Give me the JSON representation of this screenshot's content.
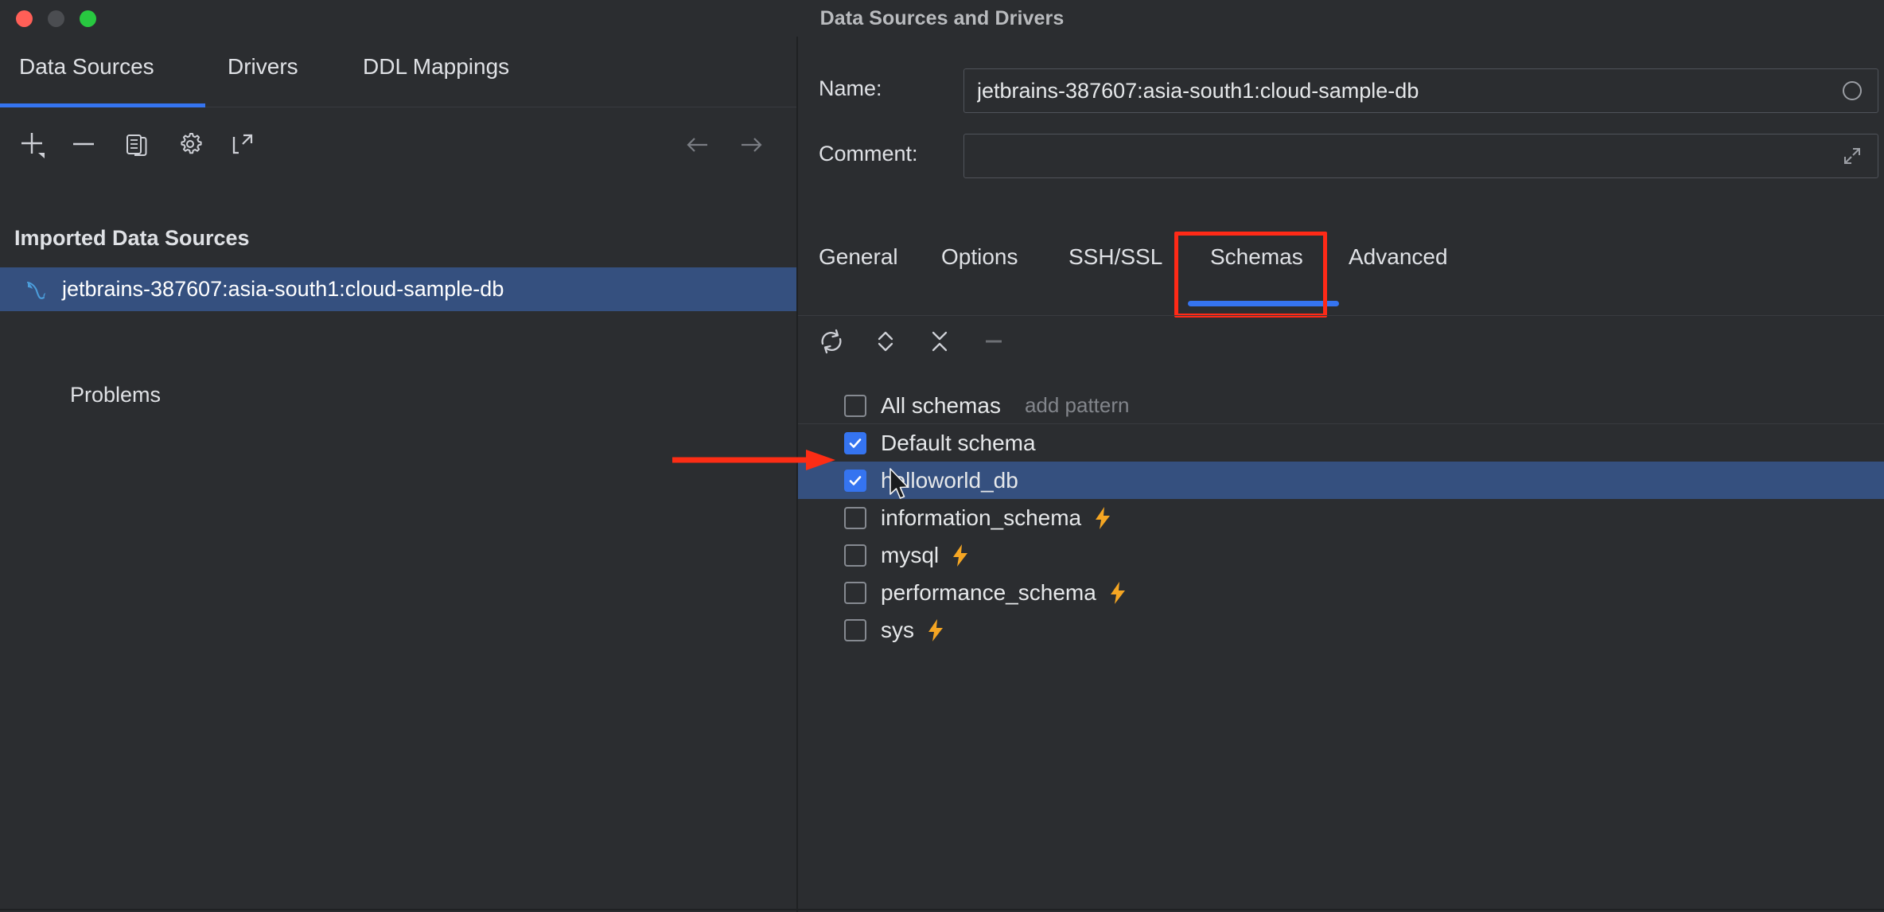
{
  "window": {
    "title": "Data Sources and Drivers",
    "traffic_lights": [
      "close-button",
      "minimize-button",
      "zoom-button"
    ]
  },
  "left_panel": {
    "tabs": [
      {
        "label": "Data Sources",
        "active": true
      },
      {
        "label": "Drivers",
        "active": false
      },
      {
        "label": "DDL Mappings",
        "active": false
      }
    ],
    "toolbar": [
      {
        "name": "add-data-source-button",
        "icon": "plus-icon"
      },
      {
        "name": "remove-data-source-button",
        "icon": "minus-icon"
      },
      {
        "name": "duplicate-data-source-button",
        "icon": "copy-icon"
      },
      {
        "name": "settings-button",
        "icon": "gear-icon"
      },
      {
        "name": "share-button",
        "icon": "external-link-icon"
      },
      {
        "name": "navigate-back-button",
        "icon": "arrow-left-icon"
      },
      {
        "name": "navigate-forward-button",
        "icon": "arrow-right-icon"
      }
    ],
    "section_title": "Imported Data Sources",
    "data_sources": [
      {
        "name": "jetbrains-387607:asia-south1:cloud-sample-db",
        "icon": "mysql-dolphin-icon",
        "selected": true
      }
    ],
    "problems_label": "Problems"
  },
  "right_panel": {
    "name_field": {
      "label": "Name:",
      "value": "jetbrains-387607:asia-south1:cloud-sample-db",
      "placeholder": "",
      "aux_icon": "circle-icon"
    },
    "comment_field": {
      "label": "Comment:",
      "value": "",
      "placeholder": "",
      "aux_icon": "expand-diagonal-icon"
    },
    "tabs": [
      {
        "label": "General",
        "active": false
      },
      {
        "label": "Options",
        "active": false
      },
      {
        "label": "SSH/SSL",
        "active": false
      },
      {
        "label": "Schemas",
        "active": true,
        "highlighted": true
      },
      {
        "label": "Advanced",
        "active": false
      }
    ],
    "schema_toolbar": [
      {
        "name": "refresh-schemas-button",
        "icon": "refresh-icon",
        "enabled": true
      },
      {
        "name": "expand-all-button",
        "icon": "expand-chevrons-icon",
        "enabled": true
      },
      {
        "name": "collapse-all-button",
        "icon": "collapse-chevrons-icon",
        "enabled": true
      },
      {
        "name": "remove-pattern-button",
        "icon": "minus-icon",
        "enabled": false
      }
    ],
    "schemas": [
      {
        "label": "All schemas",
        "checked": false,
        "selected": false,
        "bolt": false,
        "pattern_hint": "add pattern"
      },
      {
        "label": "Default schema",
        "checked": true,
        "selected": false,
        "bolt": false,
        "pattern_hint": ""
      },
      {
        "label": "helloworld_db",
        "checked": true,
        "selected": true,
        "bolt": false,
        "pattern_hint": ""
      },
      {
        "label": "information_schema",
        "checked": false,
        "selected": false,
        "bolt": true,
        "pattern_hint": ""
      },
      {
        "label": "mysql",
        "checked": false,
        "selected": false,
        "bolt": true,
        "pattern_hint": ""
      },
      {
        "label": "performance_schema",
        "checked": false,
        "selected": false,
        "bolt": true,
        "pattern_hint": ""
      },
      {
        "label": "sys",
        "checked": false,
        "selected": false,
        "bolt": true,
        "pattern_hint": ""
      }
    ]
  },
  "annotations": {
    "arrow": {
      "name": "red-pointer-arrow",
      "color": "#fc2d15",
      "points_to": "helloworld_db"
    },
    "highlight_box": {
      "name": "red-highlight-box",
      "color": "#ff2a17",
      "targets": "Schemas"
    }
  },
  "colors": {
    "background": "#2b2d30",
    "selection": "#35507f",
    "accent": "#3574f0",
    "annotation_red": "#fc2d15",
    "bolt_orange": "#f5a623",
    "mysql_icon": "#4b9ddb",
    "text_primary": "#e6e8ea",
    "text_muted": "#82858b"
  }
}
